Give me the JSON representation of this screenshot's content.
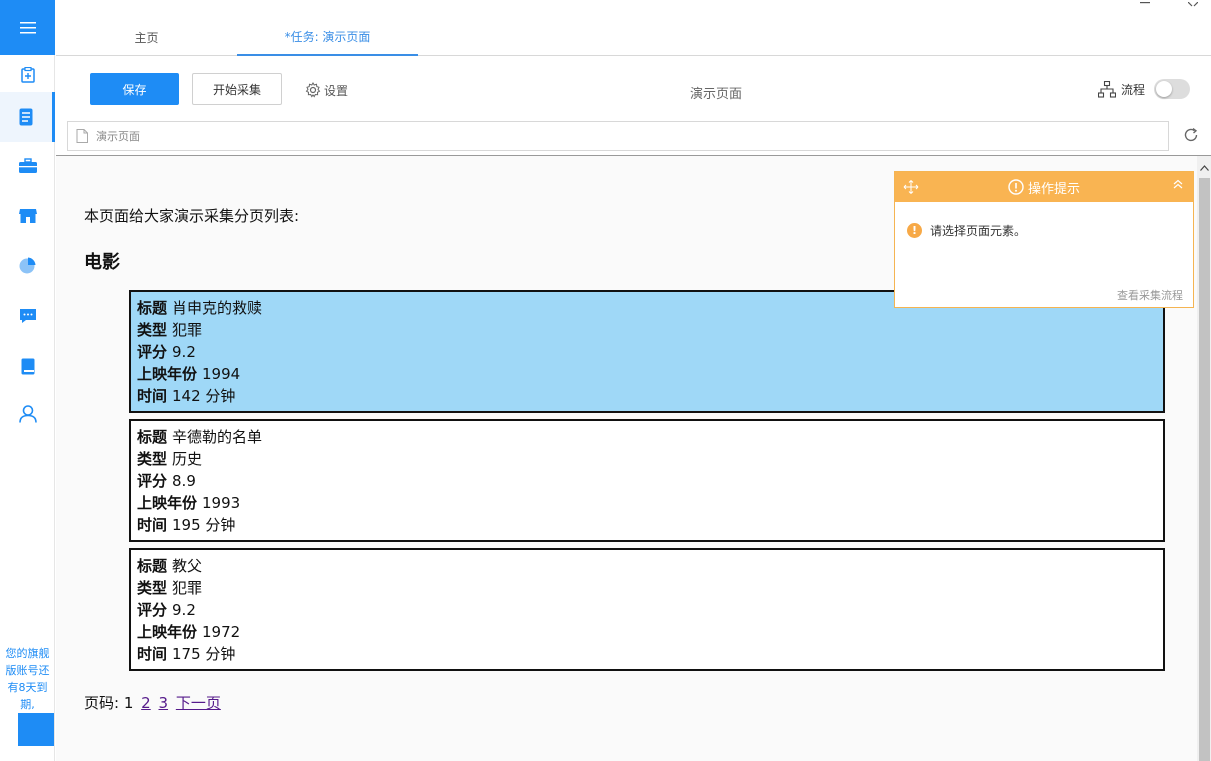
{
  "sidebar": {
    "expire_notice": "您的旗舰版账号还有8天到期,",
    "icons": [
      "menu-icon",
      "clipboard-icon",
      "document-icon",
      "briefcase-icon",
      "store-icon",
      "pie-chart-icon",
      "chat-icon",
      "book-icon",
      "user-icon"
    ]
  },
  "tabs": [
    {
      "label": "主页"
    },
    {
      "label": "*任务: 演示页面"
    }
  ],
  "toolbar": {
    "save_label": "保存",
    "start_label": "开始采集",
    "settings_label": "设置",
    "page_title": "演示页面",
    "flow_label": "流程",
    "flow_enabled": false
  },
  "address": {
    "value": "演示页面"
  },
  "content": {
    "intro": "本页面给大家演示采集分页列表:",
    "heading": "电影",
    "field_labels": {
      "title": "标题",
      "genre": "类型",
      "rating": "评分",
      "year": "上映年份",
      "duration": "时间"
    },
    "movies": [
      {
        "title": "肖申克的救赎",
        "genre": "犯罪",
        "rating": "9.2",
        "year": "1994",
        "duration": "142 分钟",
        "selected": true
      },
      {
        "title": "辛德勒的名单",
        "genre": "历史",
        "rating": "8.9",
        "year": "1993",
        "duration": "195 分钟",
        "selected": false
      },
      {
        "title": "教父",
        "genre": "犯罪",
        "rating": "9.2",
        "year": "1972",
        "duration": "175 分钟",
        "selected": false
      }
    ],
    "pager": {
      "label": "页码:",
      "current": "1",
      "page2": "2",
      "page3": "3",
      "next": "下一页"
    }
  },
  "tips": {
    "title": "操作提示",
    "message": "请选择页面元素。",
    "footer_link": "查看采集流程"
  },
  "colors": {
    "accent": "#1e8cf5",
    "selected_bg": "#9fd8f7",
    "tips_header": "#f9b452"
  }
}
